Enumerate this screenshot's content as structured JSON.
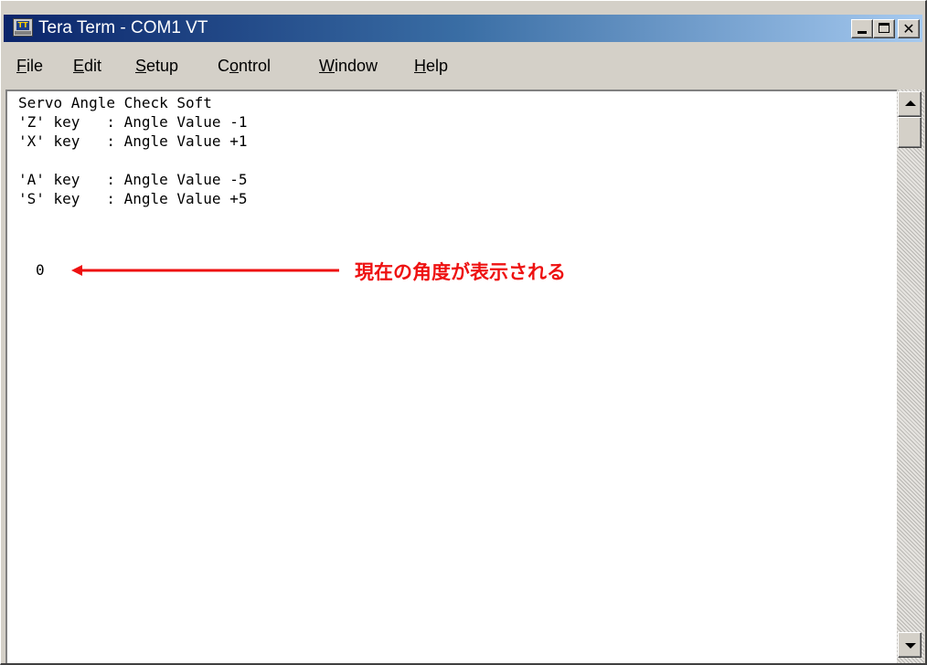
{
  "window": {
    "title": "Tera Term - COM1 VT",
    "icon": "teraterm-icon",
    "icon_text": "TT",
    "controls": [
      "minimize-icon",
      "maximize-icon",
      "close-icon"
    ],
    "close_glyph": "✕"
  },
  "menu": [
    {
      "label": "File",
      "mnemonic": "F",
      "rest": "ile"
    },
    {
      "label": "Edit",
      "mnemonic": "E",
      "rest": "dit"
    },
    {
      "label": "Setup",
      "mnemonic": "S",
      "rest": "etup"
    },
    {
      "label": "Control",
      "pre": "C",
      "mnemonic": "o",
      "rest": "ntrol"
    },
    {
      "label": "Window",
      "mnemonic": "W",
      "rest": "indow"
    },
    {
      "label": "Help",
      "mnemonic": "H",
      "rest": "elp"
    }
  ],
  "terminal": {
    "lines": [
      "Servo Angle Check Soft",
      "'Z' key   : Angle Value -1",
      "'X' key   : Angle Value +1",
      "",
      "'A' key   : Angle Value -5",
      "'S' key   : Angle Value +5"
    ],
    "angle_value": "0"
  },
  "annotation": {
    "text": "現在の角度が表示される",
    "color": "#ee1111"
  },
  "colors": {
    "titlebar_start": "#0a246a",
    "titlebar_end": "#a6caf0",
    "chrome": "#d4d0c8"
  }
}
